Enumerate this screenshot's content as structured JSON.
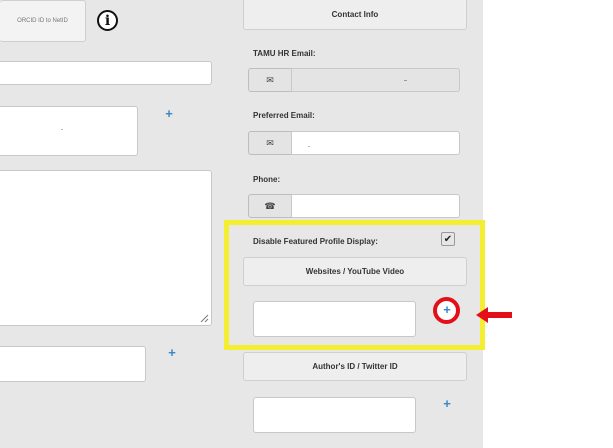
{
  "left_column": {
    "orcid_button_label": "ORCID ID to NetID",
    "info_icon_glyph": "i"
  },
  "right_column": {
    "contact_info_label": "Contact Info",
    "tamu_hr_email_label": "TAMU HR Email:",
    "preferred_email_label": "Preferred Email:",
    "phone_label": "Phone:",
    "email_icon_glyph": "✉",
    "phone_icon_glyph": "☎",
    "disable_featured_label": "Disable Featured Profile Display:",
    "checkbox_mark": "✔",
    "websites_label": "Websites / YouTube Video",
    "authors_id_label": "Author's ID / Twitter ID",
    "plus_glyph": "+",
    "disable_featured_checked": true
  },
  "annotations": {
    "highlight_color": "#f4ee33",
    "circle_color": "#e3101a",
    "arrow_color": "#e3101a"
  }
}
